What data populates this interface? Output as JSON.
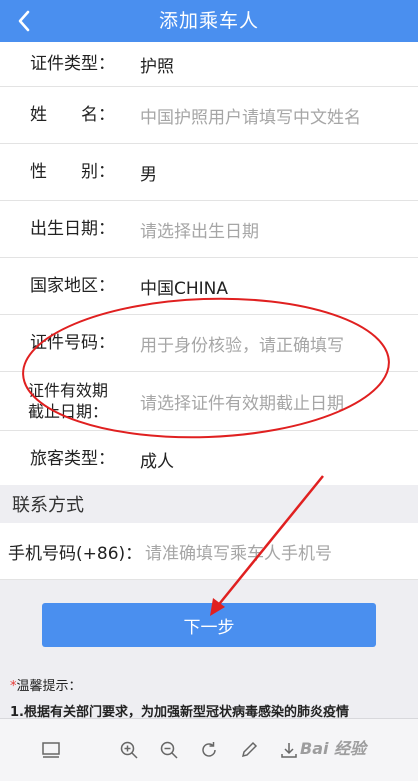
{
  "header": {
    "title": "添加乘车人",
    "back_icon": "chevron-left-icon"
  },
  "form": {
    "rows": [
      {
        "label": "证件类型：",
        "value": "护照",
        "placeholder": false
      },
      {
        "label": "姓　　名：",
        "value": "中国护照用户请填写中文姓名",
        "placeholder": true
      },
      {
        "label": "性　　别：",
        "value": "男",
        "placeholder": false
      },
      {
        "label": "出生日期：",
        "value": "请选择出生日期",
        "placeholder": true
      },
      {
        "label": "国家地区：",
        "value": "中国CHINA",
        "placeholder": false
      },
      {
        "label": "证件号码：",
        "value": "用于身份核验，请正确填写",
        "placeholder": true
      },
      {
        "label_line1": "证件有效期",
        "label_line2": "截止日期：",
        "value": "请选择证件有效期截止日期",
        "placeholder": true
      },
      {
        "label": "旅客类型：",
        "value": "成人",
        "placeholder": false
      }
    ]
  },
  "contact": {
    "section_title": "联系方式",
    "phone_label": "手机号码(+86)：",
    "phone_placeholder": "请准确填写乘车人手机号"
  },
  "next_button": "下一步",
  "tips": {
    "star": "*",
    "title": "温馨提示：",
    "line1": "1.根据有关部门要求，为加强新型冠状病毒感染的肺炎疫情"
  },
  "toolbar": {
    "icons": [
      "screen-icon",
      "zoom-in-icon",
      "zoom-out-icon",
      "rotate-icon",
      "pen-icon",
      "download-icon"
    ]
  },
  "watermark": "Bai 经验",
  "colors": {
    "accent": "#4a8fef",
    "annotation": "#e02020"
  }
}
